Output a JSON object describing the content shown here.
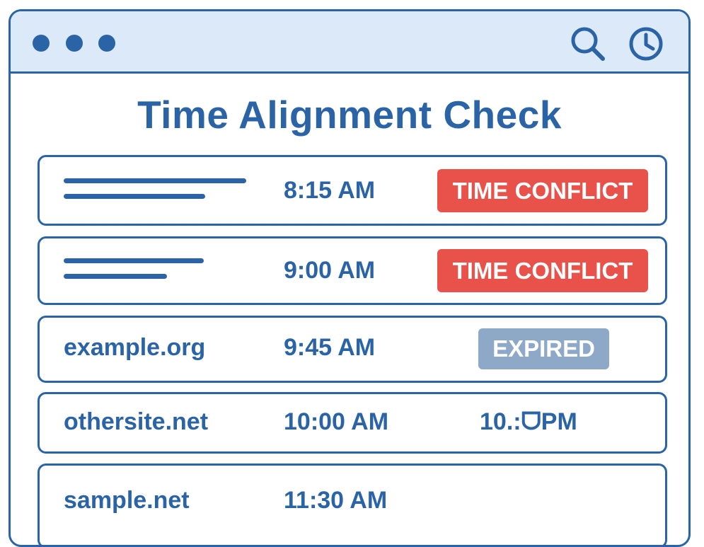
{
  "window": {
    "controls": [
      "window-dot",
      "window-dot",
      "window-dot"
    ],
    "toolbar_icons": [
      "search-icon",
      "clock-icon"
    ]
  },
  "page": {
    "title": "Time Alignment Check"
  },
  "rows": [
    {
      "site": "",
      "site_shown_as": "placeholder-lines",
      "time": "8:15 AM",
      "status": "TIME CONFLICT",
      "status_style": "red-badge"
    },
    {
      "site": "",
      "site_shown_as": "placeholder-lines",
      "time": "9:00 AM",
      "status": "TIME CONFLICT",
      "status_style": "red-badge"
    },
    {
      "site": "example.org",
      "time": "9:45 AM",
      "status": "EXPIRED",
      "status_style": "gray-badge"
    },
    {
      "site": "othersite.net",
      "time": "10:00 AM",
      "status": "10.:ᗜPM",
      "status_style": "plain-text"
    },
    {
      "site": "sample.net",
      "time": "11:30 AM",
      "status": "",
      "status_style": "none"
    }
  ],
  "colors": {
    "accent": "#2b64a6",
    "titlebar_bg": "#dce9f8",
    "conflict": "#e8524a",
    "expired": "#8ea9c8",
    "background": "#ffffff"
  }
}
